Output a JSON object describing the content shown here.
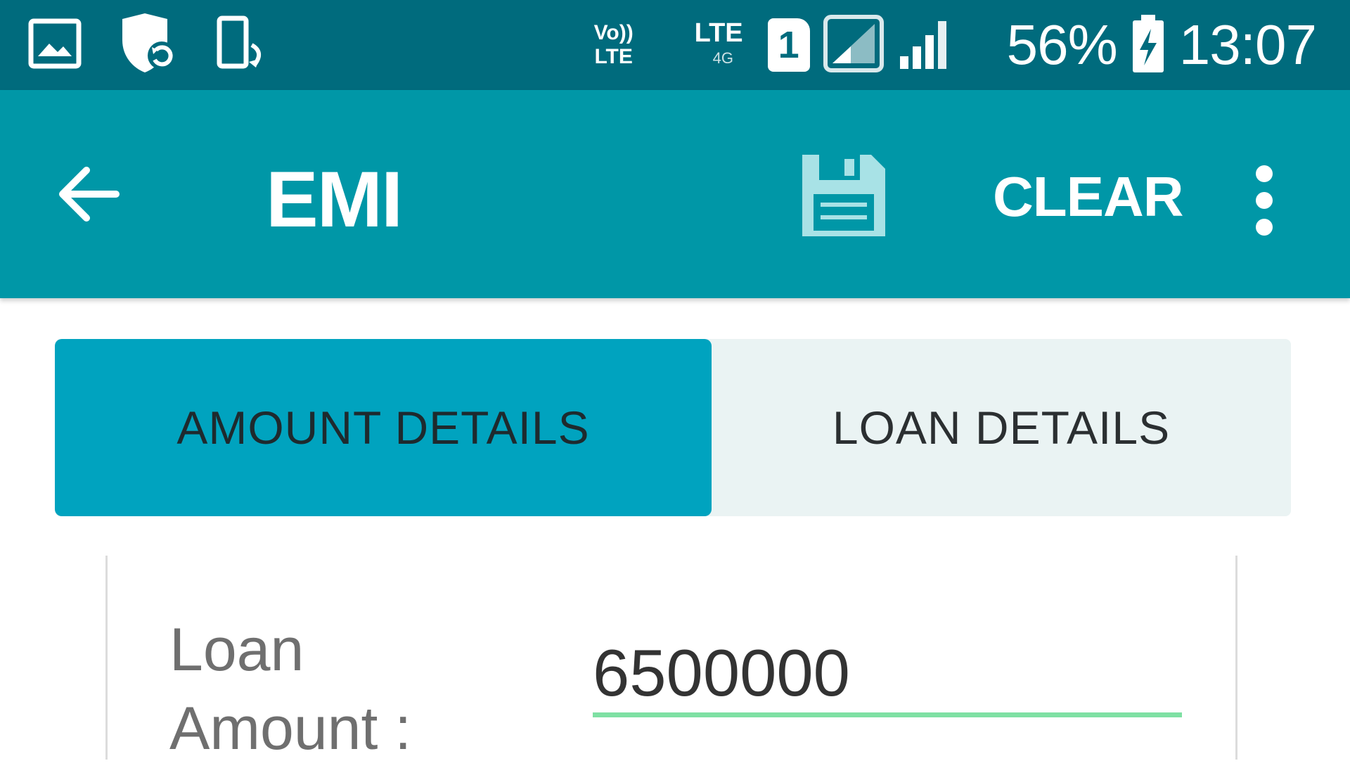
{
  "status_bar": {
    "left_icons": [
      "gallery-icon",
      "shield-icon",
      "phone-rotate-icon"
    ],
    "volte_line1": "Vo))",
    "volte_line2": "LTE",
    "lte_label": "LTE",
    "lte_sub": "4G",
    "sim_number": "1",
    "battery_percent": "56%",
    "time": "13:07"
  },
  "app_bar": {
    "title": "EMI",
    "clear_label": "CLEAR",
    "background_color": "#0097a7"
  },
  "tabs": [
    {
      "label": "AMOUNT DETAILS",
      "active": true
    },
    {
      "label": "LOAN DETAILS",
      "active": false
    }
  ],
  "form": {
    "loan_amount_label_line1": "Loan",
    "loan_amount_label_line2": "Amount :",
    "loan_amount_value": "6500000"
  },
  "colors": {
    "status_bar": "#006b7d",
    "active_tab": "#00a3bf",
    "input_underline": "#7ee0a3"
  }
}
